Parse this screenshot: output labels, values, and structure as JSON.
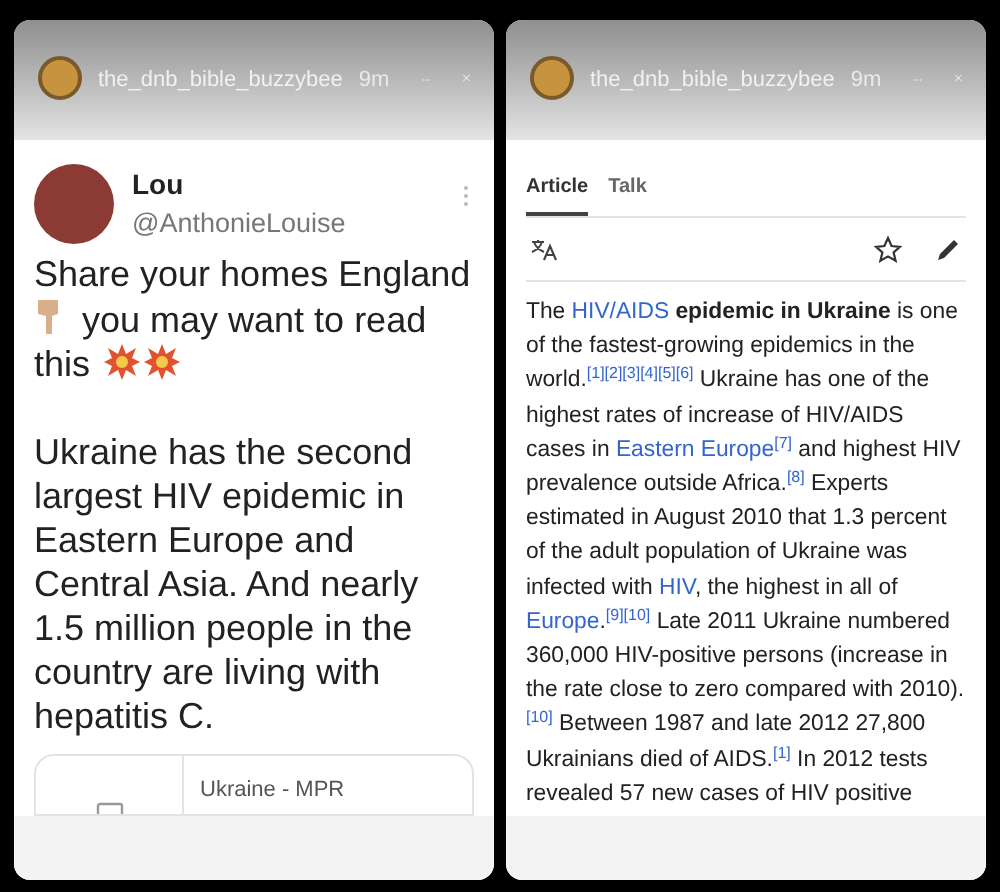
{
  "stories": [
    {
      "kind": "tweet",
      "user": "the_dnb_bible_buzzybee",
      "time": "9m",
      "tweet": {
        "name": "Lou",
        "handle": "@AnthonieLouise",
        "intro_lines": [
          {
            "kind": "plain",
            "text": "Share your homes England"
          },
          {
            "kind": "pointing",
            "text": "you may want to read"
          },
          {
            "kind": "burst",
            "text": "this"
          }
        ],
        "body": "Ukraine has the second largest HIV epidemic in Eastern Europe and Central Asia. And nearly 1.5 million people in the country are living with hepatitis C.",
        "link_title": "Ukraine - MPR"
      }
    },
    {
      "kind": "article",
      "user": "the_dnb_bible_buzzybee",
      "time": "9m",
      "tabs": [
        {
          "label": "Article",
          "selected": true
        },
        {
          "label": "Talk",
          "selected": false
        }
      ],
      "paragraph": [
        {
          "kind": "text",
          "text": "The "
        },
        {
          "kind": "link",
          "text": "HIV/AIDS"
        },
        {
          "kind": "text",
          "text": " **epidemic in Ukraine** is one of the fastest-growing epidemics in the world.$^{[1][2][3][4][5][6]}$ Ukraine has one of the highest rates of increase of HIV/AIDS cases in "
        },
        {
          "kind": "link",
          "text": "Eastern Europe"
        },
        {
          "kind": "text",
          "text": "$^{[7]}$ and highest HIV prevalence outside Africa.$^{[8]}$ Experts estimated in August 2010 that 1.3 percent of the adult population of Ukraine was infected with "
        },
        {
          "kind": "link",
          "text": "HIV"
        },
        {
          "kind": "text",
          "text": ", the highest in all of "
        },
        {
          "kind": "link",
          "text": "Europe"
        },
        {
          "kind": "text",
          "text": ".$^{[9][10]}$ Late 2011 Ukraine numbered 360,000 HIV-positive persons (increase in the rate close to zero compared with 2010).$^{[10]}$ Between 1987 and late 2012 27,800 Ukrainians died of AIDS.$^{[1]}$ In 2012 tests revealed 57 new cases of HIV positive"
        }
      ]
    }
  ]
}
